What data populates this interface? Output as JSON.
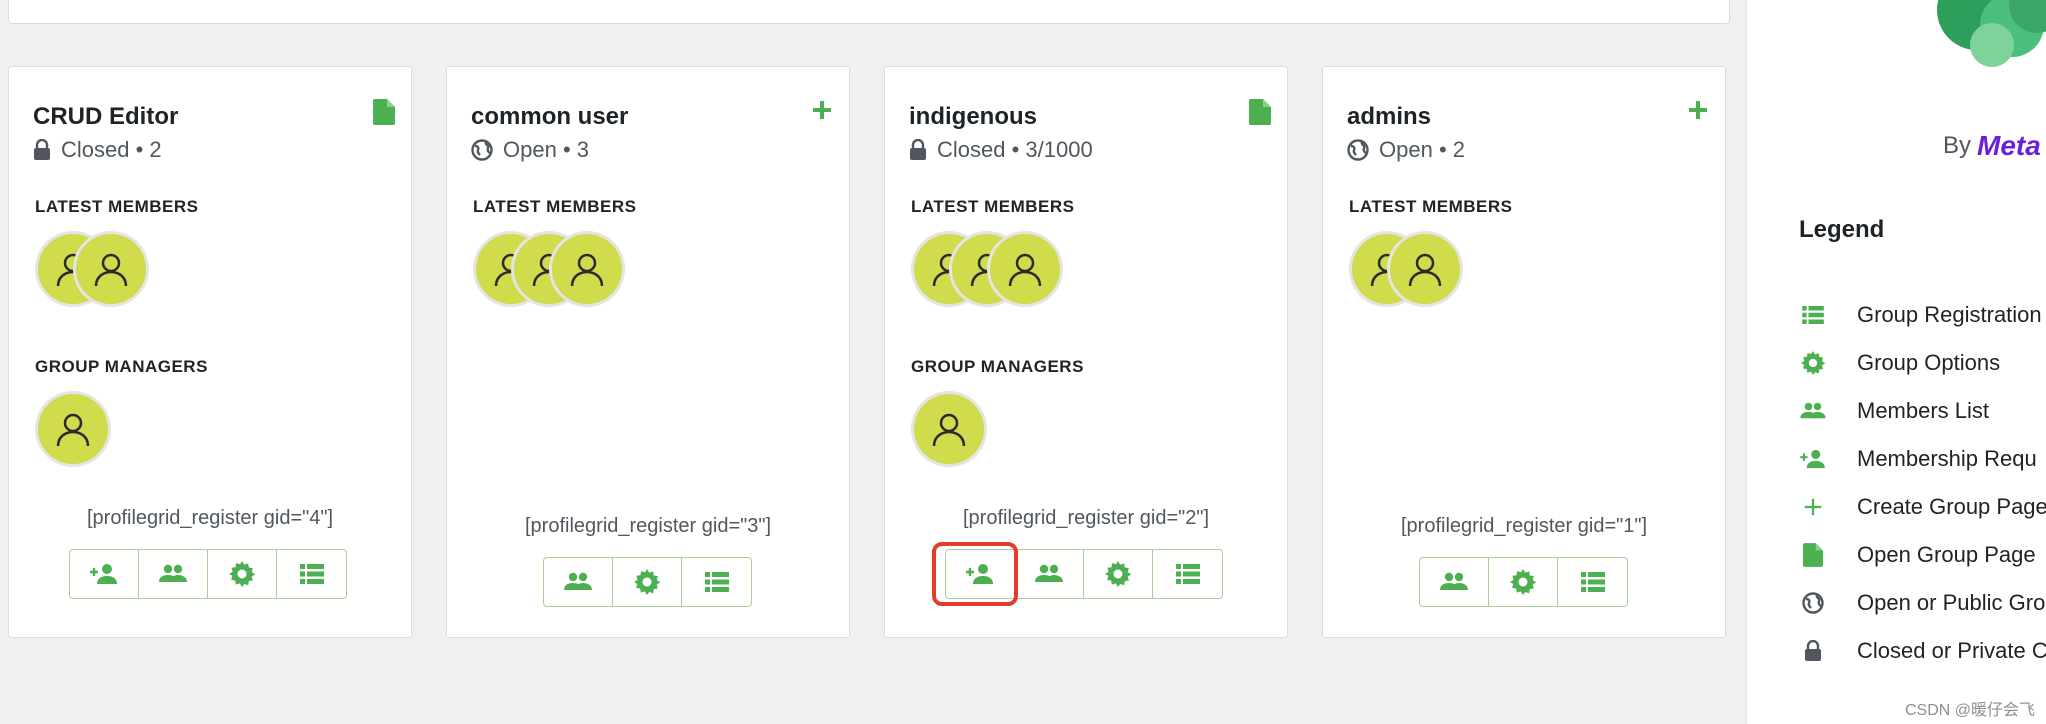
{
  "groups": [
    {
      "title": "CRUD Editor",
      "status": "Closed",
      "count": "2",
      "corner_icon": "file-icon",
      "latest_members_label": "LATEST MEMBERS",
      "group_managers_label": "GROUP MANAGERS",
      "shortcode": "[profilegrid_register gid=\"4\"]",
      "actions": [
        "membership-requests",
        "members-list",
        "group-options",
        "group-registration"
      ]
    },
    {
      "title": "common user",
      "status": "Open",
      "count": "3",
      "corner_icon": "plus-icon",
      "latest_members_label": "LATEST MEMBERS",
      "shortcode": "[profilegrid_register gid=\"3\"]",
      "actions": [
        "members-list",
        "group-options",
        "group-registration"
      ]
    },
    {
      "title": "indigenous",
      "status": "Closed",
      "count": "3/1000",
      "corner_icon": "file-icon",
      "latest_members_label": "LATEST MEMBERS",
      "group_managers_label": "GROUP MANAGERS",
      "shortcode": "[profilegrid_register gid=\"2\"]",
      "actions": [
        "membership-requests",
        "members-list",
        "group-options",
        "group-registration"
      ]
    },
    {
      "title": "admins",
      "status": "Open",
      "count": "2",
      "corner_icon": "plus-icon",
      "latest_members_label": "LATEST MEMBERS",
      "shortcode": "[profilegrid_register gid=\"1\"]",
      "actions": [
        "members-list",
        "group-options",
        "group-registration"
      ]
    }
  ],
  "sidebar": {
    "by_text": "By",
    "brand": "Meta",
    "legend_title": "Legend",
    "legend_items": [
      {
        "label": "Group Registration",
        "icon": "list-icon"
      },
      {
        "label": "Group Options",
        "icon": "gear-icon"
      },
      {
        "label": "Members List",
        "icon": "people-icon"
      },
      {
        "label": "Membership Requ",
        "icon": "person-add-icon"
      },
      {
        "label": "Create Group Page",
        "icon": "plus-icon"
      },
      {
        "label": "Open Group Page",
        "icon": "file-icon"
      },
      {
        "label": "Open or Public Gro",
        "icon": "globe-icon"
      },
      {
        "label": "Closed or Private C",
        "icon": "lock-icon"
      }
    ]
  },
  "watermark": "CSDN @暖仔会飞",
  "colors": {
    "accent_green": "#4caf50",
    "avatar_bg": "#d0dc4b",
    "highlight_red": "#e33c2c",
    "brand_purple": "#6b1fd6"
  }
}
